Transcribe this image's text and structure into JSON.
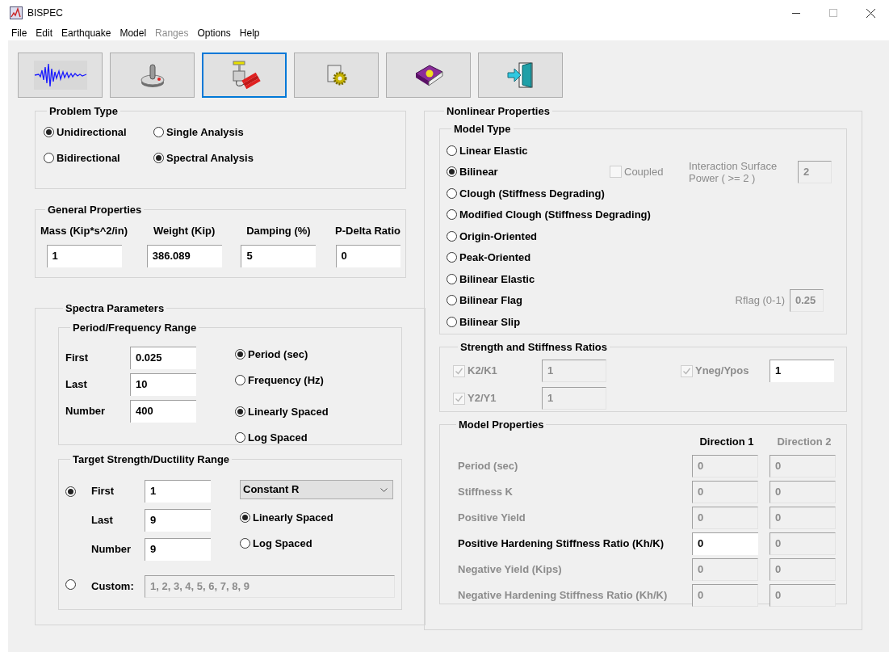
{
  "window": {
    "title": "BISPEC"
  },
  "menu": [
    {
      "label": "File",
      "disabled": false
    },
    {
      "label": "Edit",
      "disabled": false
    },
    {
      "label": "Earthquake",
      "disabled": false
    },
    {
      "label": "Model",
      "disabled": false
    },
    {
      "label": "Ranges",
      "disabled": true
    },
    {
      "label": "Options",
      "disabled": false
    },
    {
      "label": "Help",
      "disabled": false
    }
  ],
  "toolbar": [
    {
      "kind": "waveform",
      "selected": false
    },
    {
      "kind": "joystick",
      "selected": false
    },
    {
      "kind": "detonator",
      "selected": true
    },
    {
      "kind": "gear",
      "selected": false
    },
    {
      "kind": "book",
      "selected": false
    },
    {
      "kind": "exit",
      "selected": false
    }
  ],
  "problem_type": {
    "title": "Problem Type",
    "options": [
      {
        "label": "Unidirectional",
        "selected": true
      },
      {
        "label": "Single Analysis",
        "selected": false
      },
      {
        "label": "Bidirectional",
        "selected": false
      },
      {
        "label": "Spectral Analysis",
        "selected": true
      }
    ]
  },
  "general_properties": {
    "title": "General Properties",
    "fields": [
      {
        "label": "Mass (Kip*s^2/in)",
        "value": "1"
      },
      {
        "label": "Weight (Kip)",
        "value": "386.089"
      },
      {
        "label": "Damping (%)",
        "value": "5"
      },
      {
        "label": "P-Delta Ratio",
        "value": "0"
      }
    ]
  },
  "spectra_parameters": {
    "title": "Spectra Parameters",
    "period_range": {
      "title": "Period/Frequency Range",
      "fields": [
        {
          "label": "First",
          "value": "0.025"
        },
        {
          "label": "Last",
          "value": "10"
        },
        {
          "label": "Number",
          "value": "400"
        }
      ],
      "unit_options": [
        {
          "label": "Period (sec)",
          "selected": true
        },
        {
          "label": "Frequency (Hz)",
          "selected": false
        }
      ],
      "spacing_options": [
        {
          "label": "Linearly Spaced",
          "selected": true
        },
        {
          "label": "Log Spaced",
          "selected": false
        }
      ]
    },
    "target_range": {
      "title": "Target Strength/Ductility Range",
      "range_selected": true,
      "fields": [
        {
          "label": "First",
          "value": "1"
        },
        {
          "label": "Last",
          "value": "9"
        },
        {
          "label": "Number",
          "value": "9"
        }
      ],
      "dropdown": "Constant R",
      "spacing_options": [
        {
          "label": "Linearly Spaced",
          "selected": true
        },
        {
          "label": "Log Spaced",
          "selected": false
        }
      ],
      "custom": {
        "label": "Custom:",
        "selected": false,
        "value": "1, 2, 3, 4, 5, 6, 7, 8, 9",
        "disabled": true
      }
    }
  },
  "nonlinear_properties": {
    "title": "Nonlinear Properties",
    "model_type": {
      "title": "Model Type",
      "options": [
        {
          "label": "Linear Elastic",
          "selected": false
        },
        {
          "label": "Bilinear",
          "selected": true,
          "coupled": {
            "label": "Coupled",
            "checked": false,
            "disabled": true
          },
          "interaction": {
            "label": "Interaction Surface Power ( >= 2 )",
            "value": "2",
            "disabled": true
          }
        },
        {
          "label": "Clough (Stiffness Degrading)",
          "selected": false
        },
        {
          "label": "Modified Clough (Stiffness Degrading)",
          "selected": false
        },
        {
          "label": "Origin-Oriented",
          "selected": false
        },
        {
          "label": "Peak-Oriented",
          "selected": false
        },
        {
          "label": "Bilinear Elastic",
          "selected": false
        },
        {
          "label": "Bilinear Flag",
          "selected": false,
          "rflag": {
            "label": "Rflag (0-1)",
            "value": "0.25",
            "disabled": true
          }
        },
        {
          "label": "Bilinear Slip",
          "selected": false
        }
      ]
    },
    "ratios": {
      "title": "Strength and  Stiffness Ratios",
      "items": [
        {
          "label": "K2/K1",
          "checked": true,
          "disabled": true,
          "value": "1",
          "value_disabled": true
        },
        {
          "label": "Yneg/Ypos",
          "checked": true,
          "disabled": true,
          "value": "1",
          "value_disabled": false
        },
        {
          "label": "Y2/Y1",
          "checked": true,
          "disabled": true,
          "value": "1",
          "value_disabled": true
        }
      ]
    },
    "model_properties": {
      "title": "Model Properties",
      "columns": [
        {
          "label": "Direction 1",
          "disabled": false
        },
        {
          "label": "Direction 2",
          "disabled": true
        }
      ],
      "rows": [
        {
          "label": "Period (sec)",
          "disabled": true,
          "values": [
            {
              "value": "0",
              "disabled": true
            },
            {
              "value": "0",
              "disabled": true
            }
          ]
        },
        {
          "label": "Stiffness K",
          "disabled": true,
          "values": [
            {
              "value": "0",
              "disabled": true
            },
            {
              "value": "0",
              "disabled": true
            }
          ]
        },
        {
          "label": "Positive Yield",
          "disabled": true,
          "values": [
            {
              "value": "0",
              "disabled": true
            },
            {
              "value": "0",
              "disabled": true
            }
          ]
        },
        {
          "label": "Positive Hardening Stiffness Ratio (Kh/K)",
          "disabled": false,
          "values": [
            {
              "value": "0",
              "disabled": false
            },
            {
              "value": "0",
              "disabled": true
            }
          ]
        },
        {
          "label": "Negative Yield   (Kips)",
          "disabled": true,
          "values": [
            {
              "value": "0",
              "disabled": true
            },
            {
              "value": "0",
              "disabled": true
            }
          ]
        },
        {
          "label": "Negative Hardening Stiffness Ratio (Kh/K)",
          "disabled": true,
          "values": [
            {
              "value": "0",
              "disabled": true
            },
            {
              "value": "0",
              "disabled": true
            }
          ]
        }
      ]
    }
  }
}
